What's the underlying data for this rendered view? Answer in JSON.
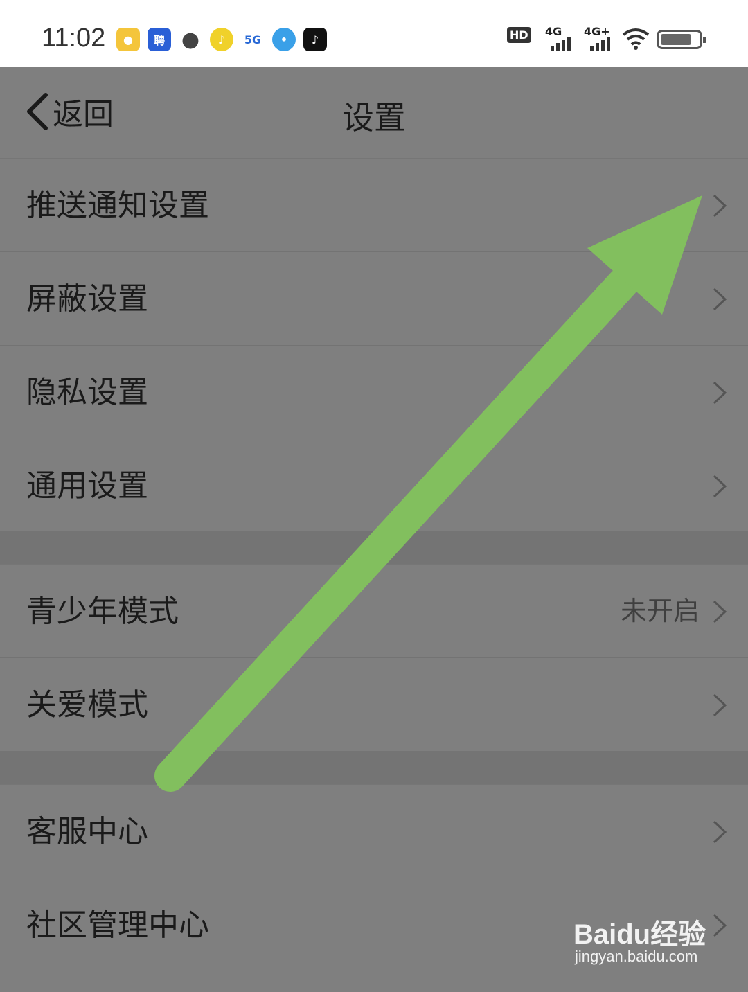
{
  "status_bar": {
    "time": "11:02",
    "network_1": "4G",
    "network_2": "4G+",
    "hd_label": "HD"
  },
  "nav": {
    "back_label": "返回",
    "title": "设置"
  },
  "groups": [
    {
      "items": [
        {
          "label": "推送通知设置",
          "value": ""
        },
        {
          "label": "屏蔽设置",
          "value": ""
        },
        {
          "label": "隐私设置",
          "value": ""
        },
        {
          "label": "通用设置",
          "value": ""
        }
      ]
    },
    {
      "items": [
        {
          "label": "青少年模式",
          "value": "未开启"
        },
        {
          "label": "关爱模式",
          "value": ""
        }
      ]
    },
    {
      "items": [
        {
          "label": "客服中心",
          "value": ""
        },
        {
          "label": "社区管理中心",
          "value": ""
        }
      ]
    }
  ],
  "annotation": {
    "type": "arrow",
    "color": "#82bf5e"
  },
  "watermark": {
    "brand": "Baidu经验",
    "url": "jingyan.baidu.com"
  },
  "colors": {
    "overlay": "#7f7f7f",
    "text": "#1a1a1a",
    "arrow": "#82bf5e"
  }
}
